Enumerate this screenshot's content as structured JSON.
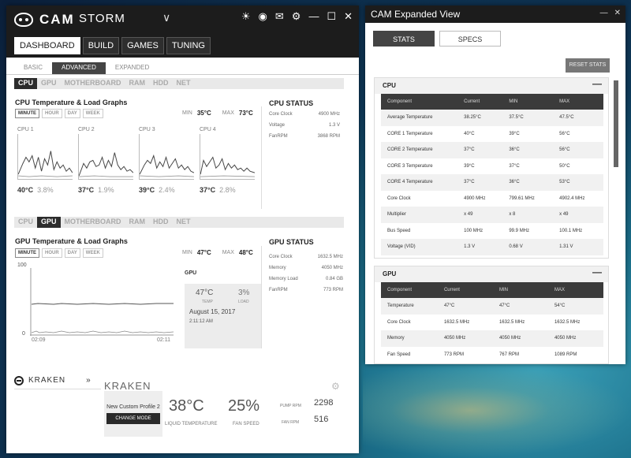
{
  "app": {
    "logo_text": "CAM",
    "profile_name": "STORM",
    "icons": [
      "brightness-icon",
      "camera-icon",
      "mail-icon",
      "gear-icon",
      "minimize-icon",
      "maximize-icon",
      "close-icon"
    ]
  },
  "main_tabs": [
    "DASHBOARD",
    "BUILD",
    "GAMES",
    "TUNING"
  ],
  "sub_tabs": [
    "BASIC",
    "ADVANCED",
    "EXPANDED"
  ],
  "hw_tabs": [
    "CPU",
    "GPU",
    "MOTHERBOARD",
    "RAM",
    "HDD",
    "NET"
  ],
  "range_buttons": [
    "MINUTE",
    "HOUR",
    "DAY",
    "WEEK"
  ],
  "cpu": {
    "title": "CPU Temperature & Load Graphs",
    "min_label": "MIN",
    "min_value": "35°C",
    "max_label": "MAX",
    "max_value": "73°C",
    "cores": [
      {
        "name": "CPU 1",
        "temp": "40°C",
        "load": "3.8%"
      },
      {
        "name": "CPU 2",
        "temp": "37°C",
        "load": "1.9%"
      },
      {
        "name": "CPU 3",
        "temp": "39°C",
        "load": "2.4%"
      },
      {
        "name": "CPU 4",
        "temp": "37°C",
        "load": "2.8%"
      }
    ],
    "status_title": "CPU STATUS",
    "status": [
      {
        "label": "Core Clock",
        "value": "4900 MHz"
      },
      {
        "label": "Voltage",
        "value": "1.3 V"
      },
      {
        "label": "FanRPM",
        "value": "3868 RPM"
      }
    ]
  },
  "gpu": {
    "title": "GPU Temperature & Load Graphs",
    "min_label": "MIN",
    "min_value": "47°C",
    "max_label": "MAX",
    "max_value": "48°C",
    "graph": {
      "y_top": "100",
      "y_bottom": "0",
      "x_start": "02:09",
      "x_end": "02:11"
    },
    "card_label": "GPU",
    "card": {
      "temp": "47°C",
      "temp_label": "TEMP",
      "load": "3%",
      "load_label": "LOAD",
      "date": "August 15, 2017",
      "time": "2:11:12 AM"
    },
    "status_title": "GPU STATUS",
    "status": [
      {
        "label": "Core Clock",
        "value": "1632.5 MHz"
      },
      {
        "label": "Memory",
        "value": "4050 MHz"
      },
      {
        "label": "Memory Load",
        "value": "0.84 GB"
      },
      {
        "label": "FanRPM",
        "value": "773 RPM"
      }
    ]
  },
  "kraken": {
    "side_label": "KRAKEN",
    "side_arrow": "»",
    "title": "KRAKEN",
    "profile": "New Custom Profile 2",
    "change_mode": "CHANGE MODE",
    "liquid_temp": "38°C",
    "liquid_temp_label": "LIQUID TEMPERATURE",
    "fan_speed": "25%",
    "fan_speed_label": "FAN SPEED",
    "pump_label": "PUMP RPM",
    "pump_value": "2298",
    "fan_rpm_label": "FAN RPM",
    "fan_rpm_value": "516"
  },
  "expanded": {
    "title": "CAM Expanded View",
    "tabs": [
      "STATS",
      "SPECS"
    ],
    "reset": "RESET STATS",
    "columns": [
      "Component",
      "Current",
      "MIN",
      "MAX"
    ],
    "cpu_panel": {
      "title": "CPU",
      "rows": [
        [
          "Average Temperature",
          "38.25°C",
          "37.5°C",
          "47.5°C"
        ],
        [
          "CORE 1 Temperature",
          "40°C",
          "39°C",
          "56°C"
        ],
        [
          "CORE 2 Temperature",
          "37°C",
          "36°C",
          "56°C"
        ],
        [
          "CORE 3 Temperature",
          "39°C",
          "37°C",
          "50°C"
        ],
        [
          "CORE 4 Temperature",
          "37°C",
          "36°C",
          "53°C"
        ],
        [
          "Core Clock",
          "4900 MHz",
          "799.61 MHz",
          "4902.4 MHz"
        ],
        [
          "Multiplier",
          "x 49",
          "x 8",
          "x 49"
        ],
        [
          "Bus Speed",
          "100 MHz",
          "99.9 MHz",
          "100.1 MHz"
        ],
        [
          "Voltage (VID)",
          "1.3 V",
          "0.68 V",
          "1.31 V"
        ]
      ]
    },
    "gpu_panel": {
      "title": "GPU",
      "rows": [
        [
          "Temperature",
          "47°C",
          "47°C",
          "54°C"
        ],
        [
          "Core Clock",
          "1632.5 MHz",
          "1632.5 MHz",
          "1632.5 MHz"
        ],
        [
          "Memory",
          "4050 MHz",
          "4050 MHz",
          "4050 MHz"
        ],
        [
          "Fan Speed",
          "773 RPM",
          "767 RPM",
          "1089 RPM"
        ]
      ]
    },
    "panel_minimize": "—"
  },
  "colors": {
    "dark": "#1c1c1c",
    "accent_gray": "#444444",
    "panel_bg": "#f1f1f1"
  }
}
